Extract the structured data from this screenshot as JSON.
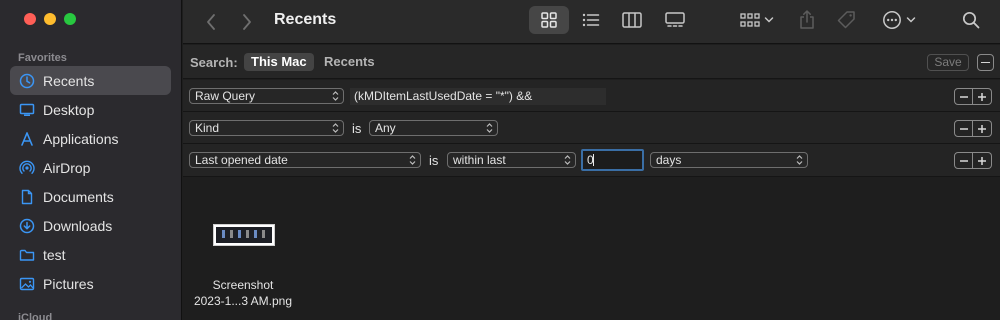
{
  "window": {
    "title": "Recents"
  },
  "sidebar": {
    "section_label": "Favorites",
    "items": [
      {
        "label": "Recents",
        "icon": "clock-icon",
        "active": true
      },
      {
        "label": "Desktop",
        "icon": "desktop-icon",
        "active": false
      },
      {
        "label": "Applications",
        "icon": "applications-icon",
        "active": false
      },
      {
        "label": "AirDrop",
        "icon": "airdrop-icon",
        "active": false
      },
      {
        "label": "Documents",
        "icon": "document-icon",
        "active": false
      },
      {
        "label": "Downloads",
        "icon": "download-icon",
        "active": false
      },
      {
        "label": "test",
        "icon": "folder-icon",
        "active": false
      },
      {
        "label": "Pictures",
        "icon": "pictures-icon",
        "active": false
      }
    ],
    "next_section_label": "iCloud"
  },
  "toolbar": {
    "views": [
      "icon-view",
      "list-view",
      "column-view",
      "gallery-view"
    ],
    "active_view": "icon-view"
  },
  "search": {
    "label": "Search:",
    "scope_selected": "This Mac",
    "scope_other": "Recents",
    "save_label": "Save"
  },
  "criteria": [
    {
      "attribute": "Raw Query",
      "query": "(kMDItemLastUsedDate = \"*\") &&"
    },
    {
      "attribute": "Kind",
      "operator_word": "is",
      "value": "Any"
    },
    {
      "attribute": "Last opened date",
      "operator_word": "is",
      "operator": "within last",
      "number": "0",
      "unit": "days"
    }
  ],
  "files": [
    {
      "name_line1": "Screenshot",
      "name_line2": "2023-1...3 AM.png"
    }
  ],
  "colors": {
    "accent": "#3a6ea5",
    "sidebar_bg": "#2b2a2e",
    "window_bg": "#1e1e1e"
  }
}
